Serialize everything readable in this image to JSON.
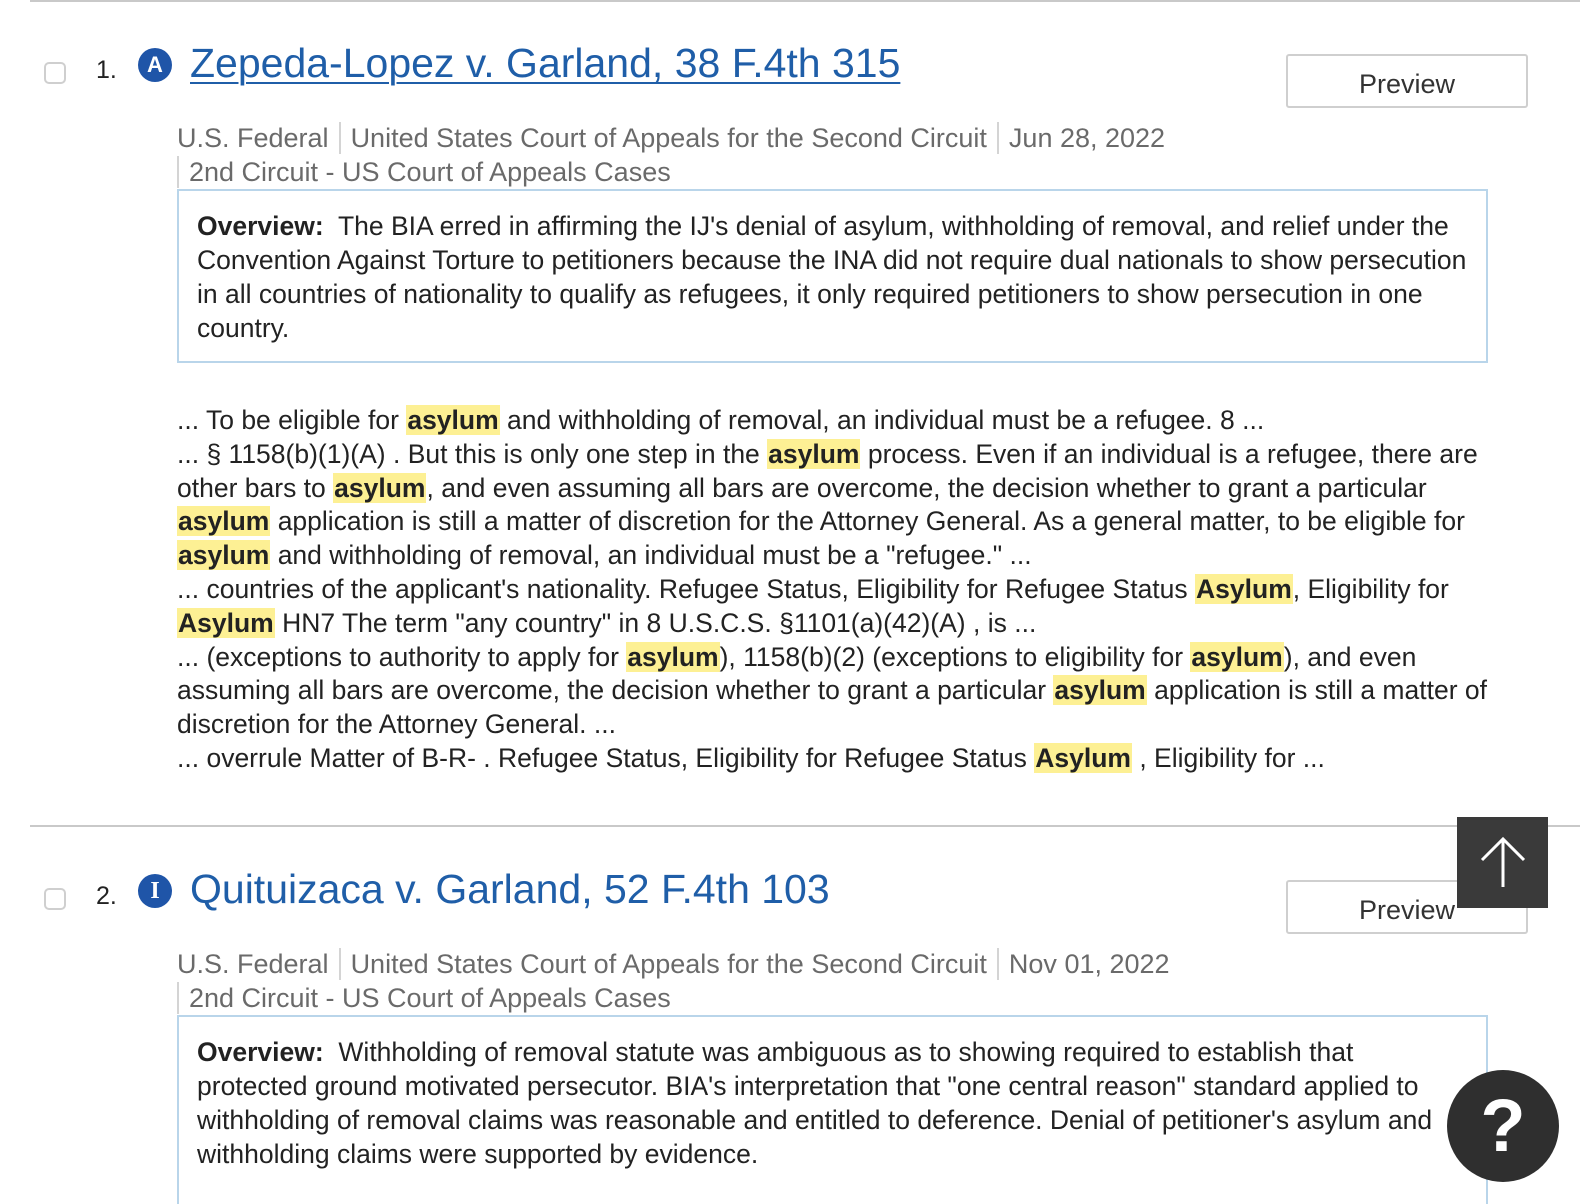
{
  "results": [
    {
      "number": "1.",
      "badge": "A",
      "title": "Zepeda-Lopez v. Garland, 38 F.4th 315",
      "preview_label": "Preview",
      "jurisdiction": "U.S. Federal",
      "court": "United States Court of Appeals for the Second Circuit",
      "date": "Jun 28, 2022",
      "source": "2nd Circuit - US Court of Appeals Cases",
      "overview_label": "Overview:",
      "overview_text": "The BIA erred in affirming the IJ's denial of asylum, withholding of removal, and relief under the Convention Against Torture to petitioners because the INA did not require dual nationals to show persecution in all countries of nationality to qualify as refugees, it only required petitioners to show persecution in one country.",
      "snippets": [
        [
          {
            "t": "... To be eligible for "
          },
          {
            "t": "asylum",
            "hl": true
          },
          {
            "t": " and withholding of removal, an individual must be a refugee. 8 ..."
          }
        ],
        [
          {
            "t": "... § 1158(b)(1)(A) . But this is only one step in the "
          },
          {
            "t": "asylum",
            "hl": true
          },
          {
            "t": " process. Even if an individual is a refugee, there are other bars to "
          },
          {
            "t": "asylum",
            "hl": true
          },
          {
            "t": ", and even assuming all bars are overcome, the decision whether to grant a particular "
          },
          {
            "t": "asylum",
            "hl": true
          },
          {
            "t": " application is still a matter of discretion for the Attorney General. As a general matter, to be eligible for "
          },
          {
            "t": "asylum",
            "hl": true
          },
          {
            "t": " and withholding of removal, an individual must be a \"refugee.\" ..."
          }
        ],
        [
          {
            "t": "... countries of the applicant's nationality. Refugee Status, Eligibility for Refugee Status "
          },
          {
            "t": "Asylum",
            "hl": true
          },
          {
            "t": ", Eligibility for "
          },
          {
            "t": "Asylum",
            "hl": true
          },
          {
            "t": " HN7 The term \"any country\" in 8 U.S.C.S. §1101(a)(42)(A) , is ..."
          }
        ],
        [
          {
            "t": "... (exceptions to authority to apply for "
          },
          {
            "t": "asylum",
            "hl": true
          },
          {
            "t": "), 1158(b)(2) (exceptions to eligibility for "
          },
          {
            "t": "asylum",
            "hl": true
          },
          {
            "t": "), and even assuming all bars are overcome, the decision whether to grant a particular "
          },
          {
            "t": "asylum",
            "hl": true
          },
          {
            "t": " application is still a matter of discretion for the Attorney General. ..."
          }
        ],
        [
          {
            "t": "... overrule Matter of B-R- . Refugee Status, Eligibility for Refugee Status "
          },
          {
            "t": "Asylum",
            "hl": true
          },
          {
            "t": " , Eligibility for ..."
          }
        ]
      ]
    },
    {
      "number": "2.",
      "badge": "I",
      "title": "Quituizaca v. Garland, 52 F.4th 103",
      "preview_label": "Preview",
      "jurisdiction": "U.S. Federal",
      "court": "United States Court of Appeals for the Second Circuit",
      "date": "Nov 01, 2022",
      "source": "2nd Circuit - US Court of Appeals Cases",
      "overview_label": "Overview:",
      "overview_text": "Withholding of removal statute was ambiguous as to showing required to establish that protected ground motivated persecutor. BIA's interpretation that \"one central reason\" standard applied to withholding of removal claims was reasonable and entitled to deference. Denial of petitioner's asylum and withholding claims were supported by evidence."
    }
  ],
  "floating": {
    "scroll_top_icon": "arrow-up-icon",
    "help_label": "?"
  },
  "colors": {
    "link": "#1f5ea8",
    "badge": "#1f55a8",
    "highlight": "#fdf094",
    "overview_border": "#b9d5ea"
  }
}
